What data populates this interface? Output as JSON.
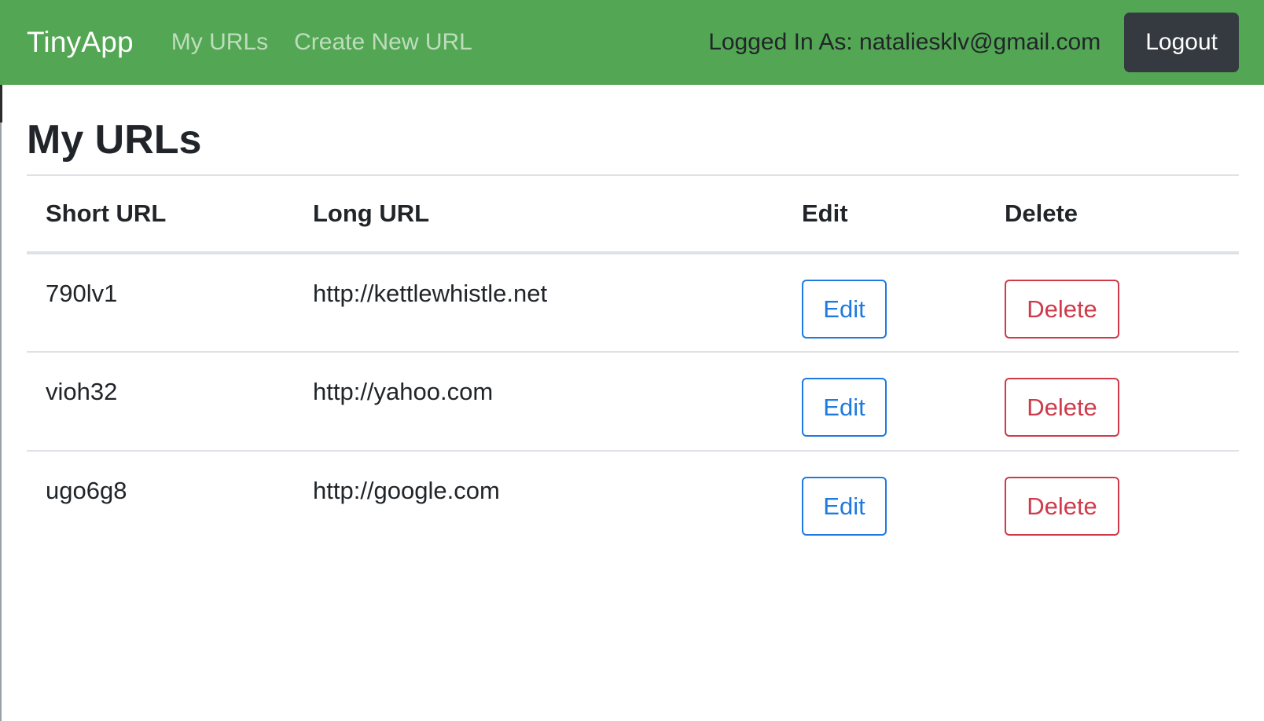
{
  "navbar": {
    "brand": "TinyApp",
    "links": [
      {
        "label": "My URLs"
      },
      {
        "label": "Create New URL"
      }
    ],
    "logged_in_text": "Logged In As: nataliesklv@gmail.com",
    "logout_label": "Logout"
  },
  "page": {
    "title": "My URLs"
  },
  "table": {
    "headers": [
      "Short URL",
      "Long URL",
      "Edit",
      "Delete"
    ],
    "rows": [
      {
        "short": "790lv1",
        "long": "http://kettlewhistle.net",
        "edit_label": "Edit",
        "delete_label": "Delete"
      },
      {
        "short": "vioh32",
        "long": "http://yahoo.com",
        "edit_label": "Edit",
        "delete_label": "Delete"
      },
      {
        "short": "ugo6g8",
        "long": "http://google.com",
        "edit_label": "Edit",
        "delete_label": "Delete"
      }
    ]
  },
  "colors": {
    "navbar_bg": "#53a653",
    "logout_bg": "#343a40",
    "edit_accent": "#1f7ae0",
    "delete_accent": "#cf3a4a"
  }
}
